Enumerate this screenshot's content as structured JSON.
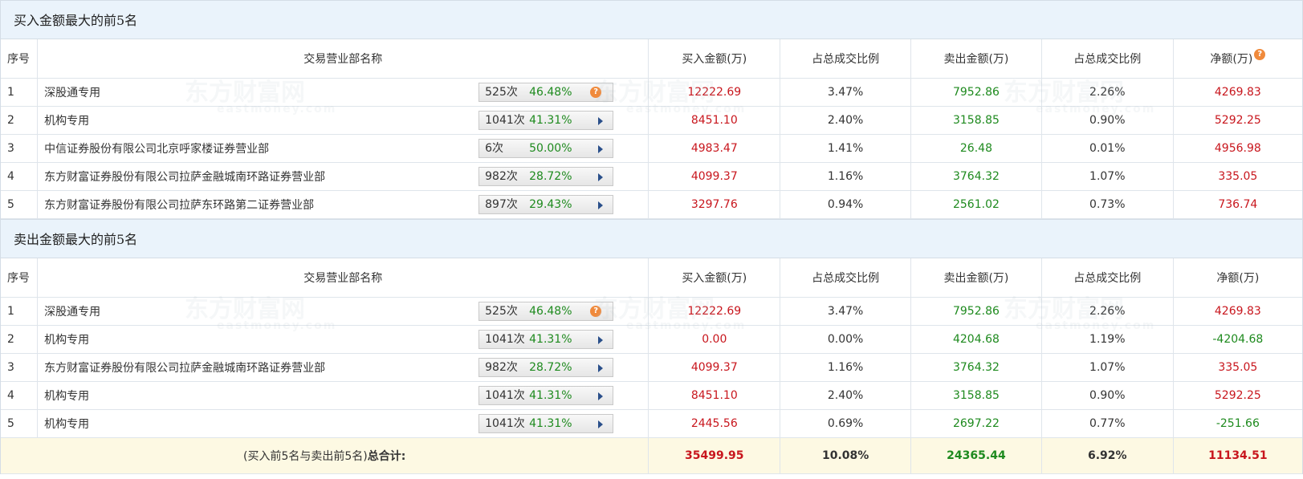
{
  "buy_section": {
    "title": "买入金额最大的前5名",
    "headers": {
      "idx": "序号",
      "name": "交易营业部名称",
      "buy": "买入金额(万)",
      "buy_ratio": "占总成交比例",
      "sell": "卖出金额(万)",
      "sell_ratio": "占总成交比例",
      "net": "净额(万)"
    },
    "rows": [
      {
        "idx": "1",
        "name": "深股通专用",
        "count": "525次",
        "pct": "46.48%",
        "action": "help-icon",
        "buy": "12222.69",
        "buy_ratio": "3.47%",
        "sell": "7952.86",
        "sell_ratio": "2.26%",
        "net": "4269.83",
        "net_color": "red"
      },
      {
        "idx": "2",
        "name": "机构专用",
        "count": "1041次",
        "pct": "41.31%",
        "action": "arrow",
        "buy": "8451.10",
        "buy_ratio": "2.40%",
        "sell": "3158.85",
        "sell_ratio": "0.90%",
        "net": "5292.25",
        "net_color": "red"
      },
      {
        "idx": "3",
        "name": "中信证券股份有限公司北京呼家楼证券营业部",
        "count": "6次",
        "pct": "50.00%",
        "action": "arrow",
        "buy": "4983.47",
        "buy_ratio": "1.41%",
        "sell": "26.48",
        "sell_ratio": "0.01%",
        "net": "4956.98",
        "net_color": "red"
      },
      {
        "idx": "4",
        "name": "东方财富证券股份有限公司拉萨金融城南环路证券营业部",
        "count": "982次",
        "pct": "28.72%",
        "action": "arrow",
        "buy": "4099.37",
        "buy_ratio": "1.16%",
        "sell": "3764.32",
        "sell_ratio": "1.07%",
        "net": "335.05",
        "net_color": "red"
      },
      {
        "idx": "5",
        "name": "东方财富证券股份有限公司拉萨东环路第二证券营业部",
        "count": "897次",
        "pct": "29.43%",
        "action": "arrow",
        "buy": "3297.76",
        "buy_ratio": "0.94%",
        "sell": "2561.02",
        "sell_ratio": "0.73%",
        "net": "736.74",
        "net_color": "red"
      }
    ]
  },
  "sell_section": {
    "title": "卖出金额最大的前5名",
    "headers": {
      "idx": "序号",
      "name": "交易营业部名称",
      "buy": "买入金额(万)",
      "buy_ratio": "占总成交比例",
      "sell": "卖出金额(万)",
      "sell_ratio": "占总成交比例",
      "net": "净额(万)"
    },
    "rows": [
      {
        "idx": "1",
        "name": "深股通专用",
        "count": "525次",
        "pct": "46.48%",
        "action": "help-icon",
        "buy": "12222.69",
        "buy_ratio": "3.47%",
        "sell": "7952.86",
        "sell_ratio": "2.26%",
        "net": "4269.83",
        "net_color": "red"
      },
      {
        "idx": "2",
        "name": "机构专用",
        "count": "1041次",
        "pct": "41.31%",
        "action": "arrow",
        "buy": "0.00",
        "buy_ratio": "0.00%",
        "sell": "4204.68",
        "sell_ratio": "1.19%",
        "net": "-4204.68",
        "net_color": "green"
      },
      {
        "idx": "3",
        "name": "东方财富证券股份有限公司拉萨金融城南环路证券营业部",
        "count": "982次",
        "pct": "28.72%",
        "action": "arrow",
        "buy": "4099.37",
        "buy_ratio": "1.16%",
        "sell": "3764.32",
        "sell_ratio": "1.07%",
        "net": "335.05",
        "net_color": "red"
      },
      {
        "idx": "4",
        "name": "机构专用",
        "count": "1041次",
        "pct": "41.31%",
        "action": "arrow",
        "buy": "8451.10",
        "buy_ratio": "2.40%",
        "sell": "3158.85",
        "sell_ratio": "0.90%",
        "net": "5292.25",
        "net_color": "red"
      },
      {
        "idx": "5",
        "name": "机构专用",
        "count": "1041次",
        "pct": "41.31%",
        "action": "arrow",
        "buy": "2445.56",
        "buy_ratio": "0.69%",
        "sell": "2697.22",
        "sell_ratio": "0.77%",
        "net": "-251.66",
        "net_color": "green"
      }
    ]
  },
  "total": {
    "label_prefix": "(买入前5名与卖出前5名)",
    "label_bold": "总合计:",
    "buy": "35499.95",
    "buy_ratio": "10.08%",
    "sell": "24365.44",
    "sell_ratio": "6.92%",
    "net": "11134.51"
  },
  "watermark": {
    "cn": "东方财富网",
    "en": "eastmoney.com"
  },
  "help_glyph": "?",
  "colors": {
    "red": "#c8161d",
    "green": "#1e8a1e",
    "section_bg": "#eaf3fb",
    "total_bg": "#fdf9e3",
    "help": "#f08a3c"
  }
}
